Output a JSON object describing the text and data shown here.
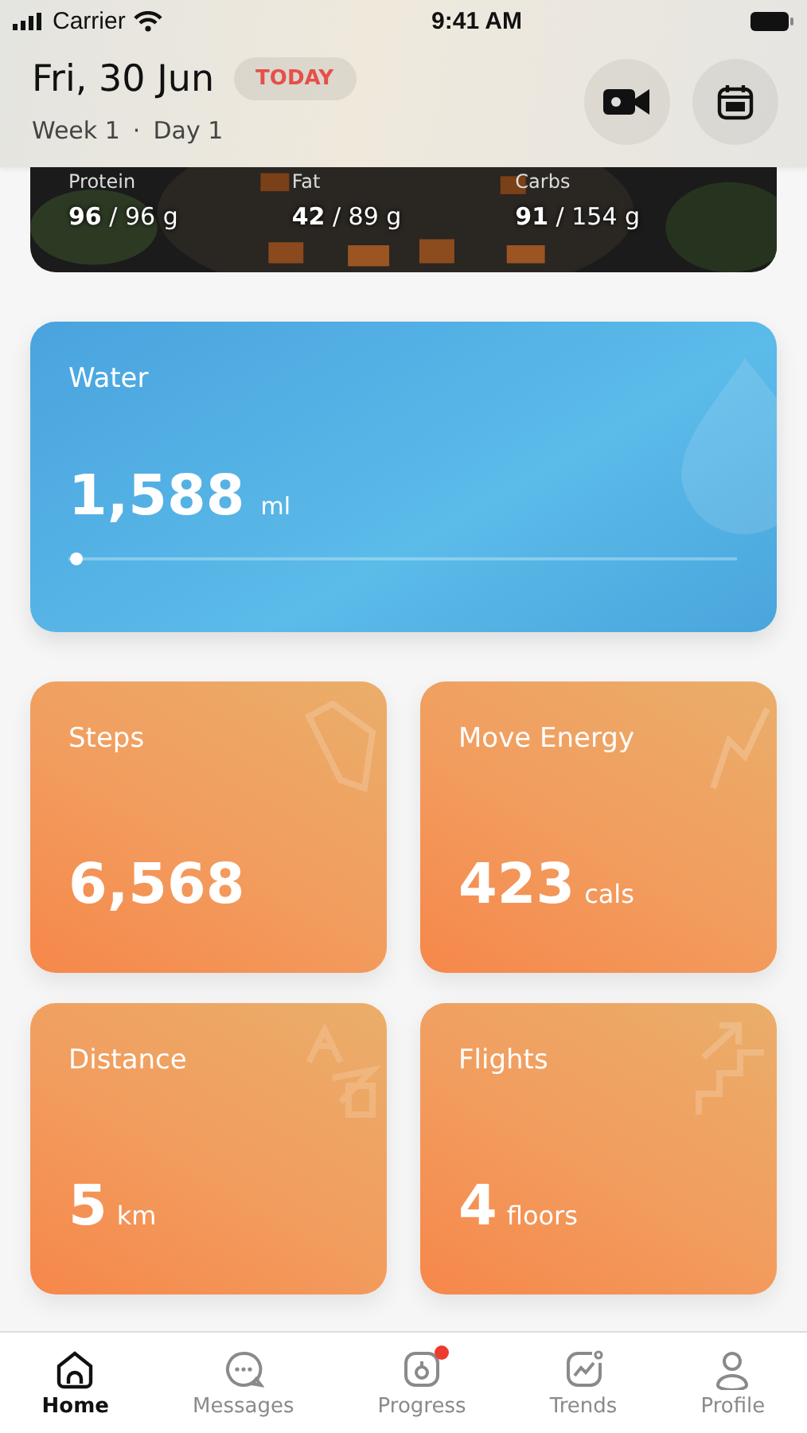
{
  "status_bar": {
    "carrier": "Carrier",
    "time": "9:41 AM"
  },
  "header": {
    "date": "Fri, 30 Jun",
    "badge": "TODAY",
    "week": "Week 1",
    "separator": "·",
    "day": "Day 1"
  },
  "meal_card": {
    "kind": "picture",
    "macros": [
      {
        "label": "Protein",
        "value": "96",
        "total": "/ 96 g"
      },
      {
        "label": "Fat",
        "value": "42",
        "total": "/ 89 g"
      },
      {
        "label": "Carbs",
        "value": "91",
        "total": "/ 154 g"
      }
    ]
  },
  "water": {
    "title": "Water",
    "value": "1,588",
    "unit": "ml",
    "level": 0.01
  },
  "tiles": [
    {
      "kind": "steps",
      "title": "Steps",
      "value": "6,568"
    },
    {
      "kind": "energy",
      "title": "Move Energy",
      "value": "423",
      "unit": "cals"
    },
    {
      "kind": "distance",
      "title": "Distance",
      "value": "5",
      "unit": "km"
    },
    {
      "kind": "flights",
      "title": "Flights",
      "value": "4",
      "unit": "floors"
    }
  ],
  "tab_bar": [
    {
      "kind": "home",
      "label": "Home",
      "selected": true,
      "badge": false
    },
    {
      "kind": "messages",
      "label": "Messages",
      "selected": false,
      "badge": false
    },
    {
      "kind": "progress",
      "label": "Progress",
      "selected": false,
      "badge": true
    },
    {
      "kind": "trends",
      "label": "Trends",
      "selected": false,
      "badge": false
    },
    {
      "kind": "profile",
      "label": "Profile",
      "selected": false,
      "badge": false
    }
  ]
}
